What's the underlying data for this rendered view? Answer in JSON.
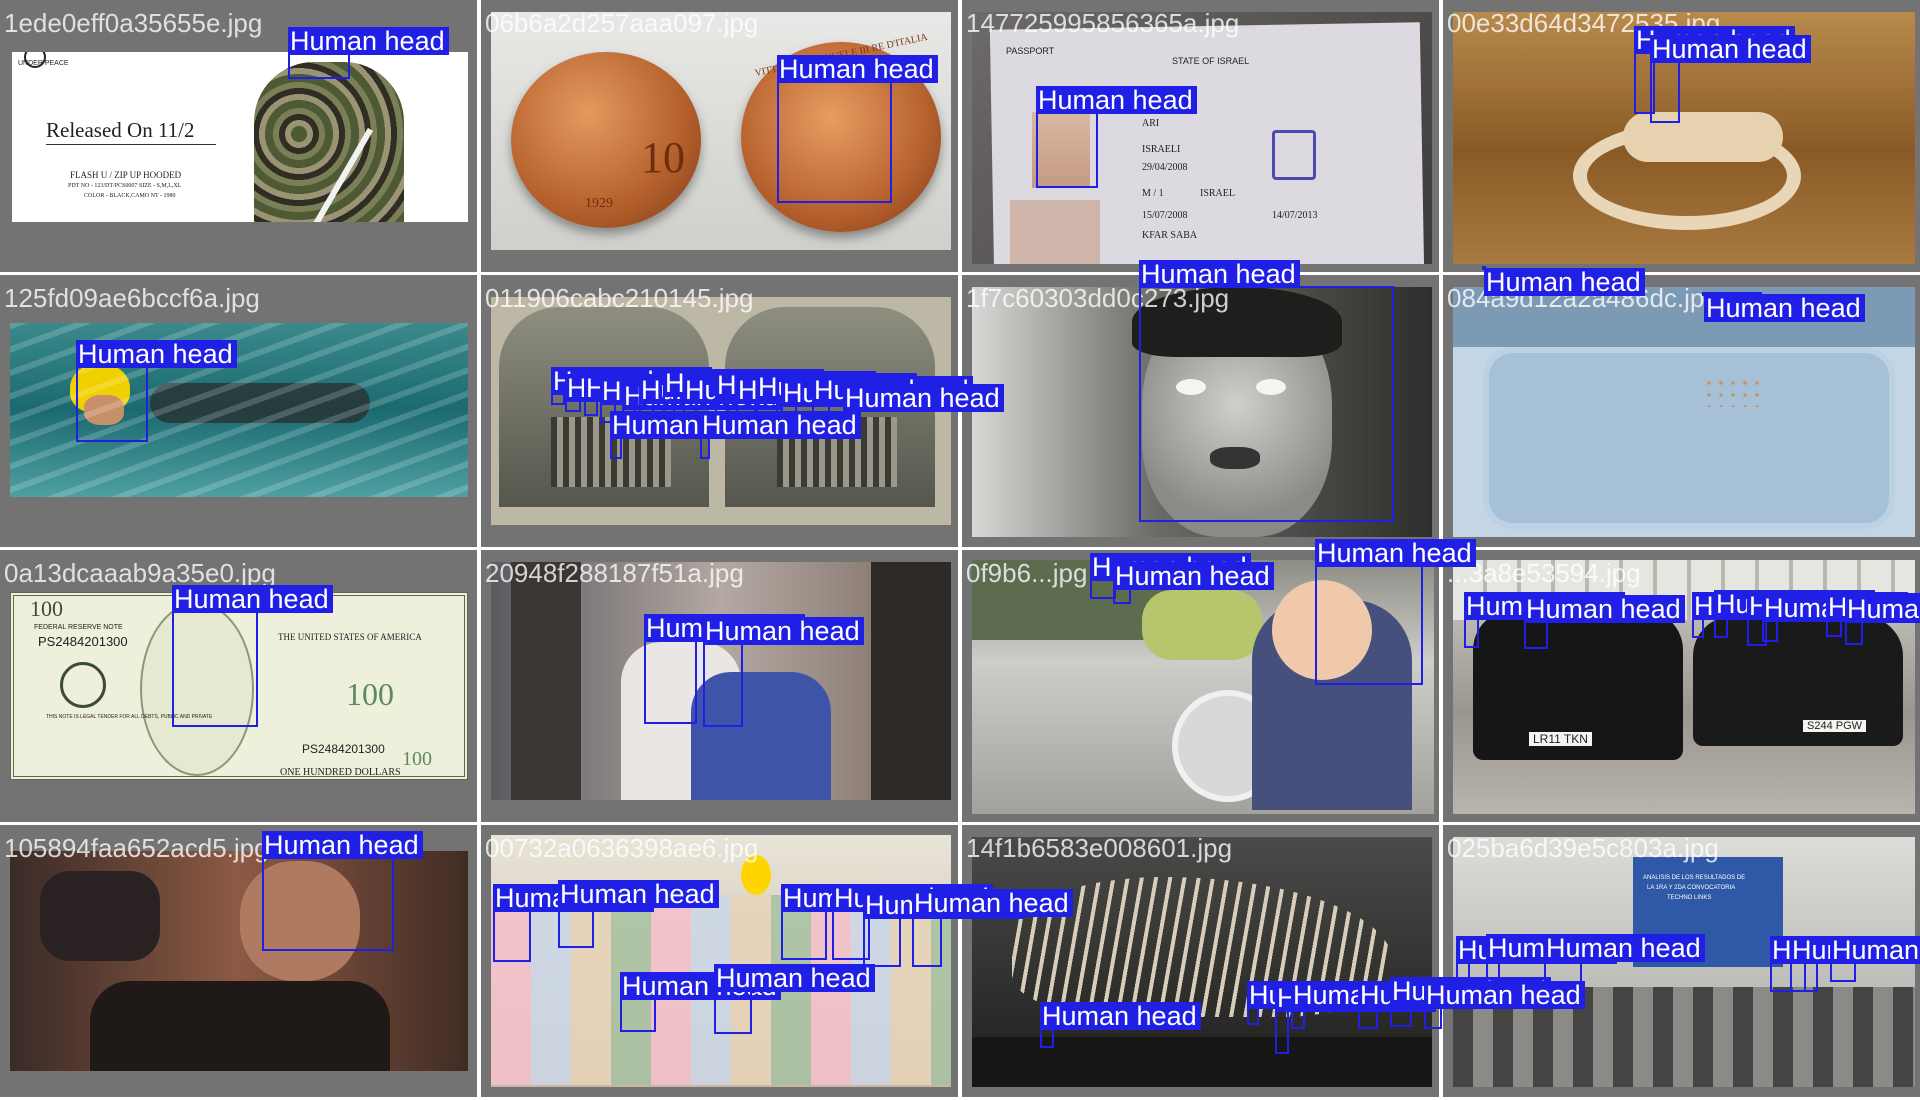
{
  "grid": {
    "cells": [
      {
        "filename": "1ede0eff0a35655e.jpg",
        "theme": "hoodie-ad",
        "photo_text": {
          "headline": "Released On  11/2",
          "sub1": "FLASH U / ZIP UP HOODED",
          "sub2": "PDT NO - 123/DT/PCS0007   SIZE - S,M,L,XL",
          "sub3": "COLOR - BLACK,CAMO   NT - 1980",
          "brand": "UNDER PEACE"
        },
        "detections": [
          {
            "label": "Human head"
          }
        ]
      },
      {
        "filename": "06b6a2d257aaa097.jpg",
        "theme": "coins",
        "photo_text": {
          "left_coin": "10",
          "year": "1929",
          "right_coin": "VITTORIO EMANUELE III RE D'ITALIA"
        },
        "detections": [
          {
            "label": "Human head"
          }
        ]
      },
      {
        "filename": "147725995856365a.jpg",
        "theme": "passport",
        "photo_text": {
          "title": "PASSPORT",
          "state": "STATE OF ISRAEL",
          "surname": "ARI",
          "nation": "ISRAELI",
          "dob": "29/04/2008",
          "sex": "M / 1",
          "issue": "15/07/2008",
          "expiry": "14/07/2013",
          "place": "KFAR SABA",
          "country": "ISRAEL"
        },
        "detections": [
          {
            "label": "Human head"
          }
        ]
      },
      {
        "filename": "00e33d64d3472535.jpg",
        "theme": "sepia-float",
        "detections": [
          {
            "label": "Human head"
          },
          {
            "label": "Human head"
          },
          {
            "label": "Human head"
          }
        ]
      },
      {
        "filename": "125fd09ae6bccf6a.jpg",
        "theme": "swimmer",
        "detections": [
          {
            "label": "Human head"
          }
        ]
      },
      {
        "filename": "011906cabc210145.jpg",
        "theme": "stereoview",
        "detections": [
          {
            "label": "Human head"
          },
          {
            "label": "Human head"
          },
          {
            "label": "Human head"
          },
          {
            "label": "Human head"
          },
          {
            "label": "Human head"
          },
          {
            "label": "Human head"
          },
          {
            "label": "Human head"
          },
          {
            "label": "Human head"
          },
          {
            "label": "Human head"
          },
          {
            "label": "Human head"
          },
          {
            "label": "Human head"
          },
          {
            "label": "Human head"
          },
          {
            "label": "Human head"
          },
          {
            "label": "Human head"
          },
          {
            "label": "Human head"
          },
          {
            "label": "Human head"
          }
        ]
      },
      {
        "filename": "1f7c60303dd0c273.jpg",
        "theme": "bw-face",
        "detections": [
          {
            "label": "Human head"
          }
        ]
      },
      {
        "filename": "084a9d12a2a486dc.jpg",
        "theme": "tray",
        "detections": [
          {
            "label": "Human head"
          }
        ]
      },
      {
        "filename": "0a13dcaaab9a35e0.jpg",
        "theme": "banknote",
        "photo_text": {
          "top": "100",
          "federal": "FEDERAL RESERVE NOTE",
          "serial1": "PS2484201300",
          "usa": "THE UNITED STATES OF AMERICA",
          "serial2": "PS2484201300",
          "hundred_big": "100",
          "corner": "100",
          "bottom": "ONE HUNDRED DOLLARS",
          "tender": "THIS NOTE IS LEGAL TENDER FOR ALL DEBTS, PUBLIC AND PRIVATE"
        },
        "detections": [
          {
            "label": "Human head"
          }
        ]
      },
      {
        "filename": "20948f288187f51a.jpg",
        "theme": "couple",
        "detections": [
          {
            "label": "Human head"
          },
          {
            "label": "Human head"
          }
        ]
      },
      {
        "filename": "0f9b6...jpg",
        "theme": "baby-street",
        "detections": [
          {
            "label": "Human head"
          },
          {
            "label": "Human head"
          },
          {
            "label": "Human head"
          }
        ]
      },
      {
        "filename": "...3a8e53594.jpg",
        "theme": "taxis",
        "photo_text": {
          "plate1": "LR11 TKN",
          "plate2": "S244 PGW"
        },
        "detections": [
          {
            "label": "Human head"
          },
          {
            "label": "Human head"
          },
          {
            "label": "Human head"
          },
          {
            "label": "Human head"
          },
          {
            "label": "Human head"
          },
          {
            "label": "Human head"
          },
          {
            "label": "Human head"
          },
          {
            "label": "Human head"
          }
        ]
      },
      {
        "filename": "105894faa652acd5.jpg",
        "theme": "camera-man",
        "detections": [
          {
            "label": "Human head"
          }
        ]
      },
      {
        "filename": "00732a0636398ae6.jpg",
        "theme": "group",
        "detections": [
          {
            "label": "Human head"
          },
          {
            "label": "Human head"
          },
          {
            "label": "Human head"
          },
          {
            "label": "Human head"
          },
          {
            "label": "Human head"
          },
          {
            "label": "Human head"
          },
          {
            "label": "Human head"
          },
          {
            "label": "Human head"
          }
        ]
      },
      {
        "filename": "14f1b6583e008601.jpg",
        "theme": "dinosaur",
        "detections": [
          {
            "label": "Human head"
          },
          {
            "label": "Human head"
          },
          {
            "label": "Human head"
          },
          {
            "label": "Human head"
          },
          {
            "label": "Human head"
          },
          {
            "label": "Human head"
          },
          {
            "label": "Human head"
          }
        ]
      },
      {
        "filename": "025ba6d39e5c803a.jpg",
        "theme": "conference",
        "photo_text": {
          "slide1": "ANALISIS DE LOS RESULTADOS DE",
          "slide2": "LA 1RA Y 2DA CONVOCATORIA",
          "slide3": "TECHNO LINKS"
        },
        "detections": [
          {
            "label": "Human head"
          },
          {
            "label": "Human head"
          },
          {
            "label": "Human head"
          },
          {
            "label": "Human head"
          },
          {
            "label": "Human head"
          },
          {
            "label": "Human head"
          }
        ]
      }
    ]
  },
  "colors": {
    "cell_bg": "#737373",
    "box": "#1f1fe6",
    "tag_text": "#ffffff",
    "filename_text": "#ffffff"
  }
}
